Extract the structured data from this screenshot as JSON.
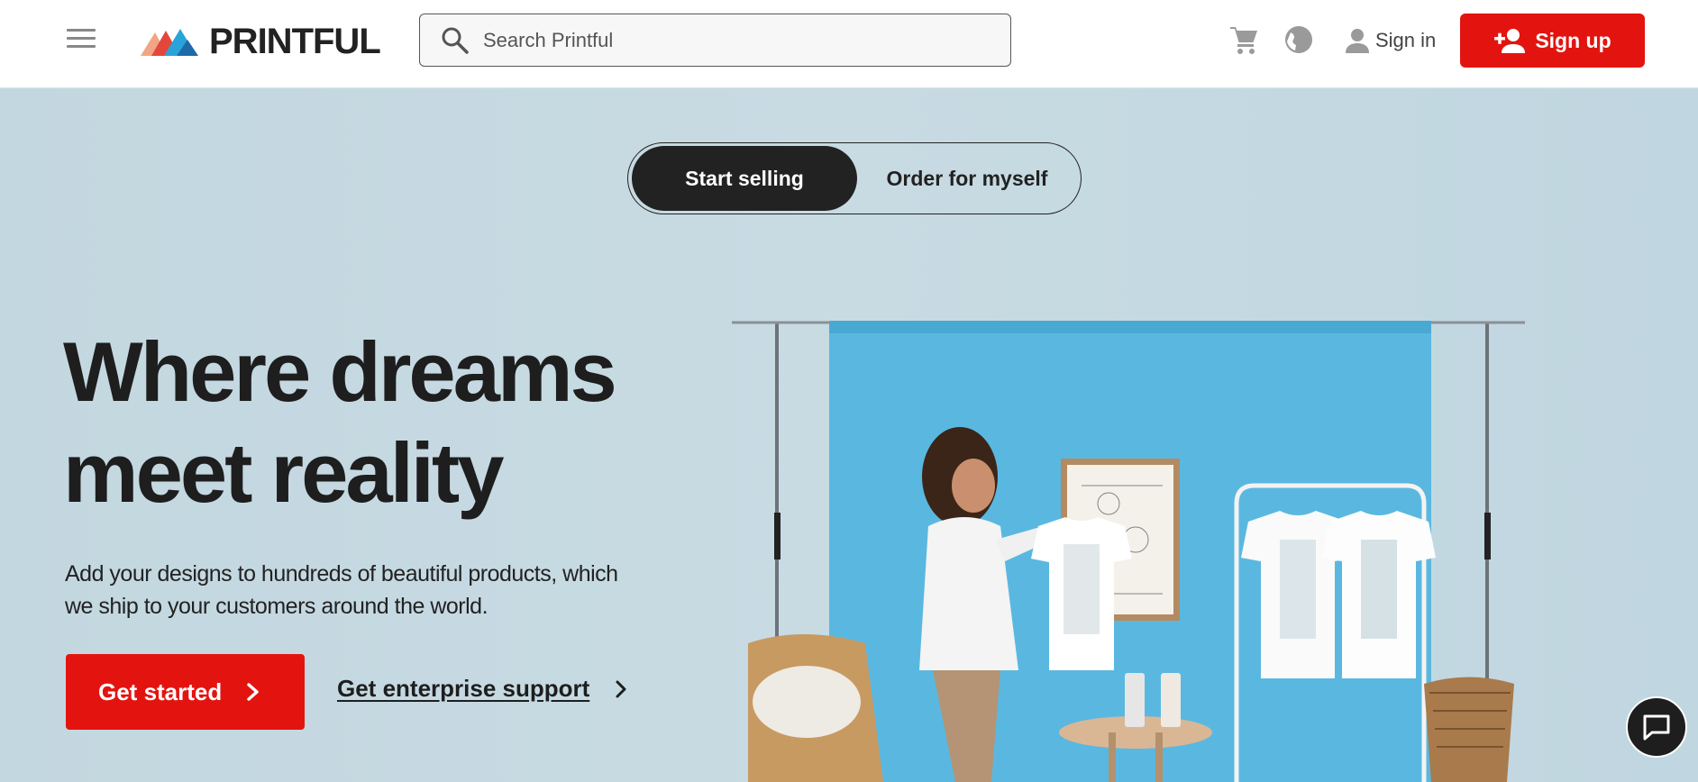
{
  "header": {
    "menu_icon": "hamburger-menu-icon",
    "logo_text": "PRINTFUL",
    "search": {
      "placeholder": "Search Printful",
      "icon": "search-icon"
    },
    "cart_icon": "cart-icon",
    "globe_icon": "globe-icon",
    "signin_label": "Sign in",
    "signup_label": "Sign up"
  },
  "hero": {
    "toggle": {
      "active": "Start selling",
      "inactive": "Order for myself"
    },
    "headline_line1": "Where dreams",
    "headline_line2": "meet reality",
    "subtext": "Add your designs to hundreds of beautiful products, which we ship to your customers around the world.",
    "cta_label": "Get started",
    "enterprise_label": "Get enterprise support"
  },
  "chat_icon": "chat-bubble-icon",
  "colors": {
    "accent": "#e3140f",
    "dark": "#1e1e1e",
    "hero_bg": "#c6d9e2",
    "backdrop": "#5ab8e0"
  }
}
